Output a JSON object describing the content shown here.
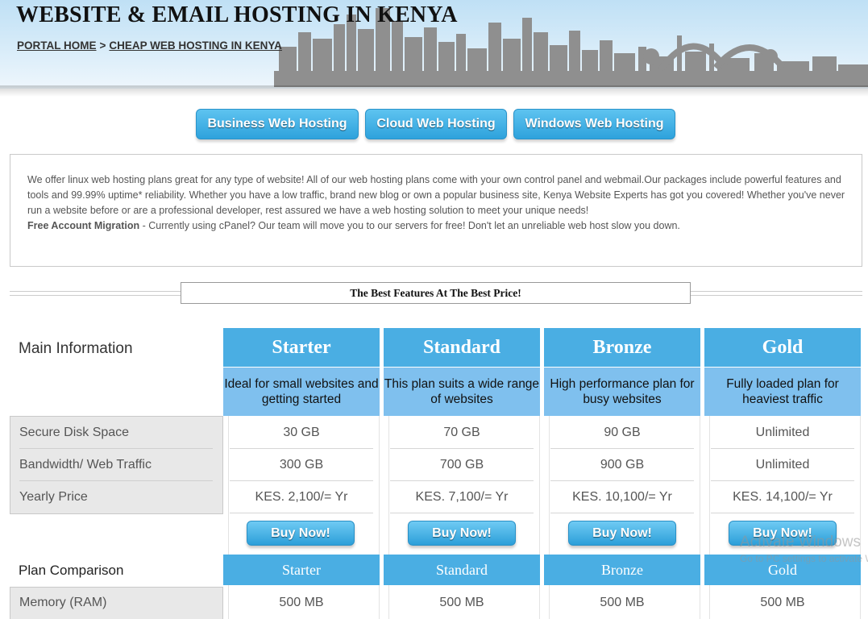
{
  "header": {
    "title": "WEBSITE & EMAIL HOSTING IN KENYA",
    "breadcrumb": [
      {
        "label": "PORTAL HOME"
      },
      {
        "label": "CHEAP WEB HOSTING IN KENYA"
      }
    ],
    "breadcrumb_sep": ">"
  },
  "nav": {
    "buttons": [
      {
        "label": "Business Web Hosting"
      },
      {
        "label": "Cloud Web Hosting"
      },
      {
        "label": "Windows Web Hosting"
      }
    ]
  },
  "intro": {
    "text": "We offer linux web hosting plans great for any type of website! All of our web hosting plans come with your own control panel and webmail.Our packages include powerful features and tools and 99.99% uptime* reliability. Whether you have a low traffic, brand new blog or own a popular business site, Kenya Website Experts has got you covered! Whether you've never run a website before or are a professional developer, rest assured we have a web hosting solution to meet your unique needs!",
    "migration_title": "Free Account Migration",
    "migration_text": " - Currently using cPanel? Our team will move you to our servers for free! Don't let an unreliable web host slow you down."
  },
  "features_heading": "The Best Features At The Best Price!",
  "pricing": {
    "main_info_label": "Main Information",
    "row_labels": [
      "Secure Disk Space",
      "Bandwidth/ Web Traffic",
      "Yearly Price"
    ],
    "buy_label": "Buy Now!",
    "plans": [
      {
        "name": "Starter",
        "desc": "Ideal for small websites and getting started",
        "disk": "30 GB",
        "bandwidth": "300 GB",
        "price": "KES. 2,100/= Yr"
      },
      {
        "name": "Standard",
        "desc": "This plan suits a wide range of websites",
        "disk": "70 GB",
        "bandwidth": "700 GB",
        "price": "KES. 7,100/= Yr"
      },
      {
        "name": "Bronze",
        "desc": "High performance plan for busy websites",
        "disk": "90 GB",
        "bandwidth": "900 GB",
        "price": "KES. 10,100/= Yr"
      },
      {
        "name": "Gold",
        "desc": "Fully loaded plan for heaviest traffic",
        "disk": "Unlimited",
        "bandwidth": "Unlimited",
        "price": "KES. 14,100/= Yr"
      }
    ]
  },
  "comparison": {
    "label": "Plan Comparison",
    "memory_label": "Memory (RAM)",
    "memory": [
      "500 MB",
      "500 MB",
      "500 MB",
      "500 MB"
    ]
  },
  "watermark": {
    "line1": "Activate Windows",
    "line2": "Go to PC settings to activate Windows."
  },
  "colors": {
    "accent": "#4aaee3",
    "accent_light": "#7fc0ee",
    "button": "#2ea2dc"
  }
}
